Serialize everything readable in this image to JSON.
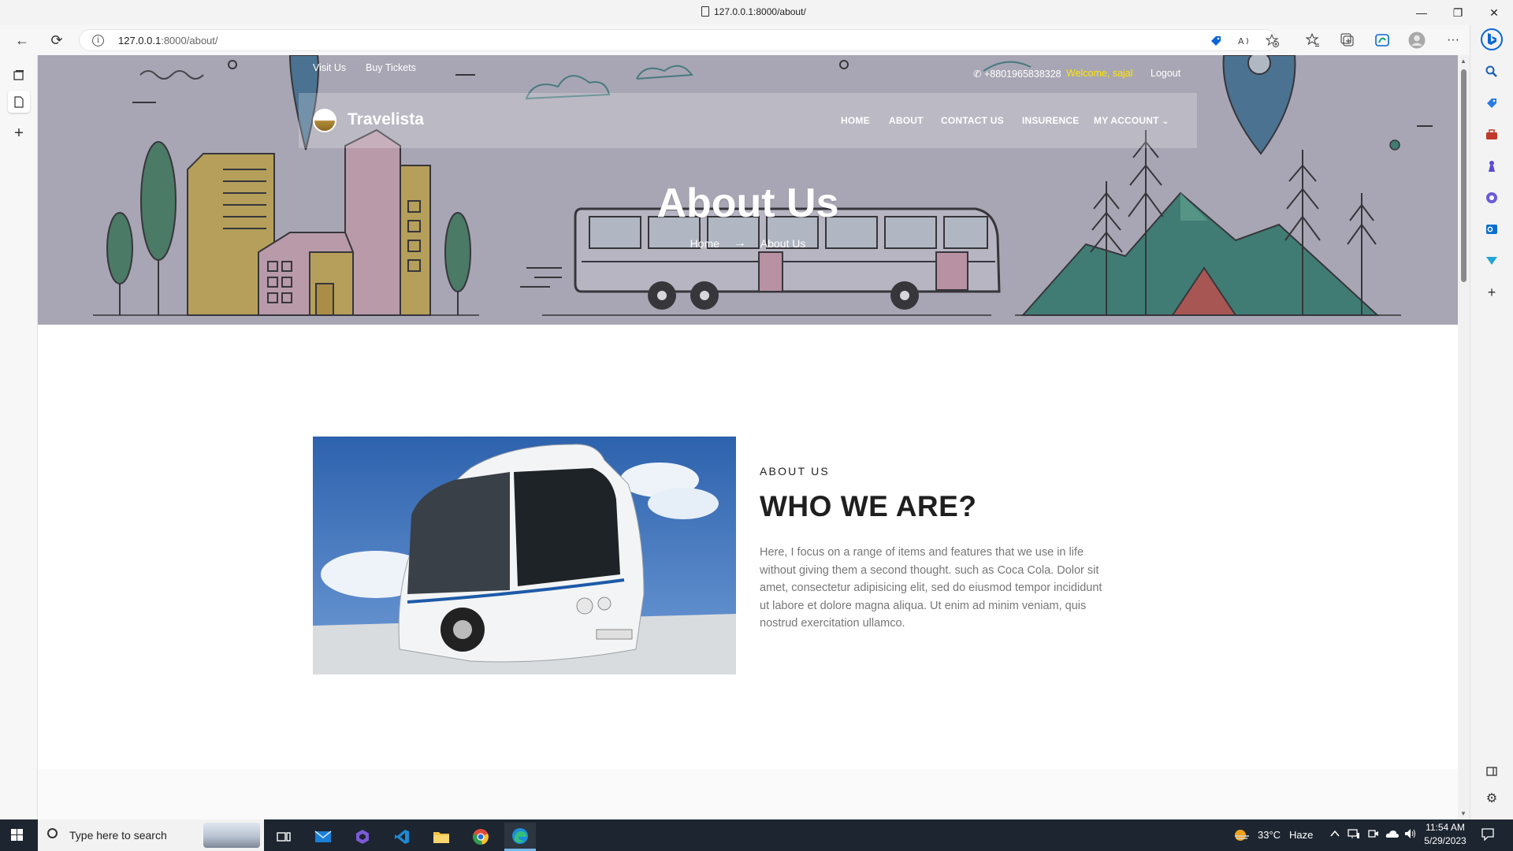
{
  "window": {
    "title": "127.0.0.1:8000/about/",
    "minimize_glyph": "—",
    "restore_glyph": "❐",
    "close_glyph": "✕"
  },
  "browser": {
    "url_host": "127.0.0.1",
    "url_rest": ":8000/about/",
    "back_icon": "←",
    "reload_icon": "⟳",
    "info_icon": "i",
    "more_icon": "···",
    "right_toolbar_icons": [
      "shopping-tag-icon",
      "read-aloud-icon",
      "favorite-add-icon",
      "favorites-icon",
      "collections-icon",
      "performance-icon",
      "profile-icon"
    ],
    "sidebar_icons": [
      "search-icon",
      "shopping-icon",
      "tools-icon",
      "games-icon",
      "office-icon",
      "outlook-icon",
      "drop-icon",
      "add-icon",
      "split-screen-icon",
      "settings-icon"
    ]
  },
  "site": {
    "top_links": [
      "Visit Us",
      "Buy Tickets"
    ],
    "phone": "+8801965838328",
    "welcome": "Welcome, sajal",
    "logout": "Logout",
    "brand": "Travelista",
    "nav": [
      "HOME",
      "ABOUT",
      "CONTACT US",
      "INSURENCE",
      "MY ACCOUNT"
    ],
    "dropdown_caret": "⌄",
    "hero_title": "About Us",
    "breadcrumb_home": "Home",
    "breadcrumb_arrow": "→",
    "breadcrumb_current": "About Us",
    "about_eyebrow": "ABOUT US",
    "about_heading": "WHO WE ARE?",
    "about_text": "Here, I focus on a range of items and features that we use in life without giving them a second thought. such as Coca Cola. Dolor sit amet, consectetur adipisicing elit, sed do eiusmod tempor incididunt ut labore et dolore magna aliqua. Ut enim ad minim veniam, quis nostrud exercitation ullamco."
  },
  "taskbar": {
    "search_placeholder": "Type here to search",
    "apps": [
      "task-view-icon",
      "mail-icon",
      "visual-studio-icon",
      "vscode-icon",
      "file-explorer-icon",
      "chrome-icon",
      "edge-icon"
    ],
    "weather_temp": "33°C",
    "weather_desc": "Haze",
    "time": "11:54 AM",
    "date": "5/29/2023"
  },
  "colors": {
    "welcome_yellow": "#ffe600",
    "taskbar_bg": "#1c2530",
    "hero_overlay": "#8e8ca0"
  }
}
